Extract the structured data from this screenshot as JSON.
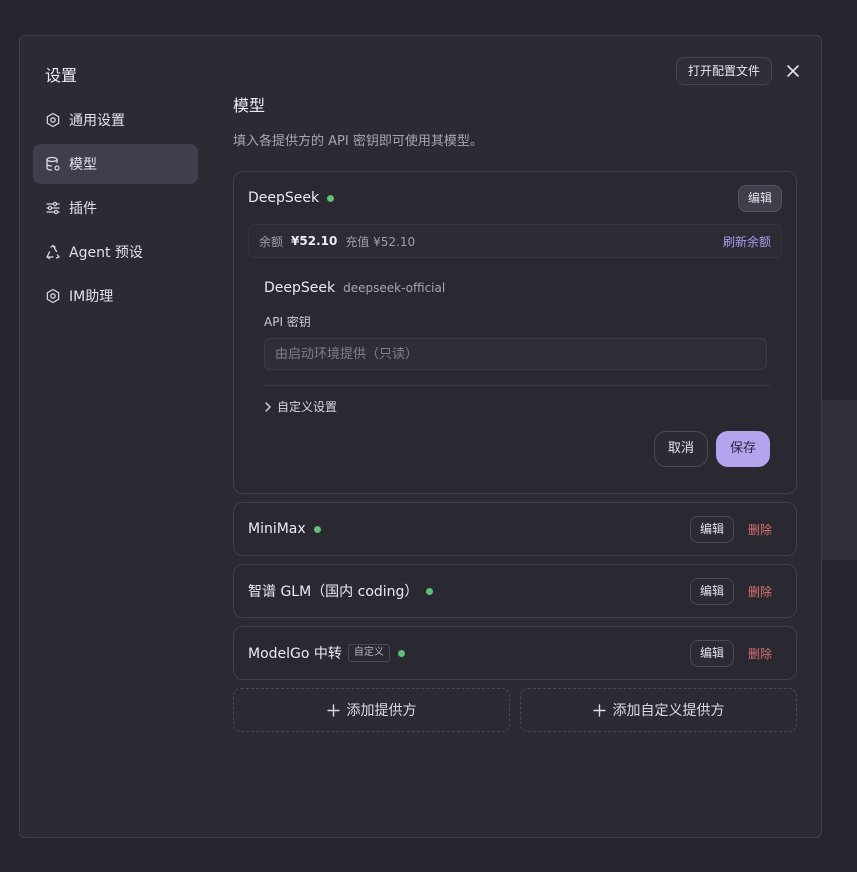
{
  "modal": {
    "title": "设置",
    "open_config_label": "打开配置文件"
  },
  "sidebar": {
    "items": [
      {
        "label": "通用设置",
        "icon": "gear-icon",
        "active": false
      },
      {
        "label": "模型",
        "icon": "database-icon",
        "active": true
      },
      {
        "label": "插件",
        "icon": "sliders-icon",
        "active": false
      },
      {
        "label": "Agent 预设",
        "icon": "recycle-icon",
        "active": false
      },
      {
        "label": "IM助理",
        "icon": "gear-icon",
        "active": false
      }
    ]
  },
  "main": {
    "title": "模型",
    "description": "填入各提供方的 API 密钥即可使用其模型。"
  },
  "deepseek": {
    "name": "DeepSeek",
    "edit_label": "编辑",
    "balance_label": "余额",
    "balance_value": "¥52.10",
    "recharge_text": "充值 ¥52.10",
    "refresh_label": "刷新余额",
    "detail_name": "DeepSeek",
    "detail_id": "deepseek-official",
    "api_key_label": "API 密钥",
    "api_key_placeholder": "由启动环境提供（只读）",
    "custom_settings_label": "自定义设置",
    "cancel_label": "取消",
    "save_label": "保存"
  },
  "providers": [
    {
      "name": "MiniMax",
      "tag": "",
      "edit_label": "编辑",
      "delete_label": "删除"
    },
    {
      "name": "智谱 GLM（国内 coding）",
      "tag": "",
      "edit_label": "编辑",
      "delete_label": "删除"
    },
    {
      "name": "ModelGo 中转",
      "tag": "自定义",
      "edit_label": "编辑",
      "delete_label": "删除"
    }
  ],
  "add": {
    "provider_label": "添加提供方",
    "custom_provider_label": "添加自定义提供方"
  },
  "colors": {
    "accent": "#b4a4ee",
    "status_ok": "#5fbf74",
    "danger": "#d8706e",
    "link": "#a99ae8"
  }
}
